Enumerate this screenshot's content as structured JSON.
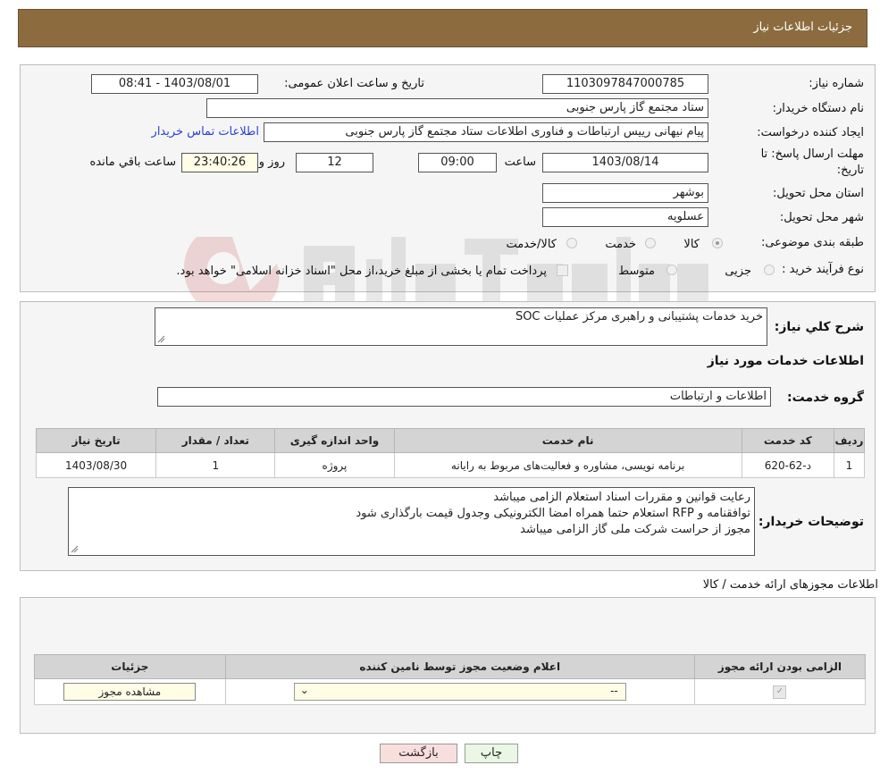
{
  "header": {
    "title": "جزئیات اطلاعات نیاز"
  },
  "fields": {
    "need_number_label": "شماره نیاز:",
    "need_number": "1103097847000785",
    "announce_label": "تاریخ و ساعت اعلان عمومی:",
    "announce_value": "1403/08/01 - 08:41",
    "buyer_org_label": "نام دستگاه خریدار:",
    "buyer_org": "ستاد مجتمع گاز پارس جنوبی",
    "creator_label": "ایجاد کننده درخواست:",
    "creator": "پیام نیهانی رییس ارتباطات و فناوری اطلاعات ستاد مجتمع گاز پارس جنوبی",
    "contact_link": "اطلاعات تماس خریدار",
    "deadline_label_1": "مهلت ارسال پاسخ: تا",
    "deadline_label_2": "تاریخ:",
    "deadline_date": "1403/08/14",
    "time_label": "ساعت",
    "deadline_time": "09:00",
    "days": "12",
    "days_label": "روز و",
    "remaining": "23:40:26",
    "remaining_label": "ساعت باقي مانده",
    "province_label": "استان محل تحویل:",
    "province": "بوشهر",
    "city_label": "شهر محل تحویل:",
    "city": "عسلویه",
    "category_label": "طبقه بندی موضوعی:",
    "cat_goods": "کالا",
    "cat_service": "خدمت",
    "cat_goods_service": "کالا/خدمت",
    "process_label": "نوع فرآیند خرید :",
    "proc_minor": "جزیی",
    "proc_medium": "متوسط",
    "proc_note": "پرداخت تمام یا بخشی از مبلغ خرید،از محل \"اسناد خزانه اسلامی\" خواهد بود."
  },
  "summary": {
    "label": "شرح کلي نياز:",
    "value": "خرید خدمات پشتیبانی و راهبری مرکز عملیات SOC",
    "services_title": "اطلاعات خدمات مورد نياز",
    "group_label": "گروه خدمت:",
    "group_value": "اطلاعات و ارتباطات"
  },
  "services_table": {
    "headers": [
      "رديف",
      "کد خدمت",
      "نام خدمت",
      "واحد اندازه گيری",
      "تعداد / مقدار",
      "تاريخ نياز"
    ],
    "rows": [
      [
        "1",
        "د-62-620",
        "برنامه نویسی، مشاوره و فعالیت‌های مربوط به رایانه",
        "پروژه",
        "1",
        "1403/08/30"
      ]
    ]
  },
  "buyer_notes": {
    "label": "توضيحات خريدار:",
    "line1": "رعایت قوانین و مقررات  اسناد استعلام الزامی میباشد",
    "line2": "توافقنامه و RFP  استعلام حتما همراه امضا الکترونیکی وجدول قیمت بارگذاری شود",
    "line3": "مجوز از حراست شرکت ملی گاز الزامی میباشد"
  },
  "permits": {
    "title": "اطلاعات مجوزهای ارائه خدمت / کالا",
    "headers": [
      "الزامی بودن ارائه مجوز",
      "اعلام وضعیت مجوز توسط نامین کننده",
      "جزئیات"
    ],
    "select_value": "--",
    "view_button": "مشاهده مجوز"
  },
  "buttons": {
    "print": "چاپ",
    "back": "بازگشت"
  },
  "colors": {
    "header_bg": "#8c6c3f",
    "panel_bg": "#f5f5f5",
    "link": "#2a3fd2",
    "back_btn": "#f9dede",
    "print_btn": "#eaf7e4",
    "select_bg": "#fffde6"
  }
}
